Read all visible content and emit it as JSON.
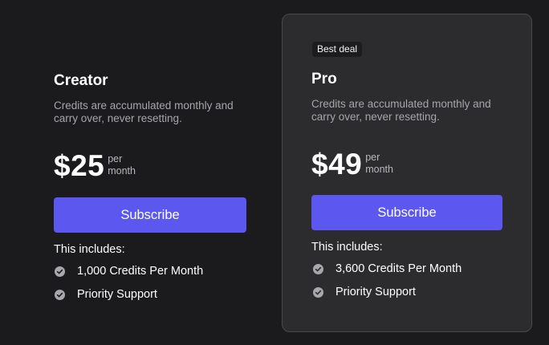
{
  "plans": [
    {
      "name": "Creator",
      "description": "Credits are accumulated monthly and carry over, never resetting.",
      "price": "$25",
      "period_line1": "per",
      "period_line2": "month",
      "button_label": "Subscribe",
      "includes_label": "This includes:",
      "features": [
        "1,000 Credits Per Month",
        "Priority Support"
      ]
    },
    {
      "badge": "Best deal",
      "name": "Pro",
      "description": "Credits are accumulated monthly and carry over, never resetting.",
      "price": "$49",
      "period_line1": "per",
      "period_line2": "month",
      "button_label": "Subscribe",
      "includes_label": "This includes:",
      "features": [
        "3,600 Credits Per Month",
        "Priority Support"
      ]
    }
  ],
  "colors": {
    "background": "#1b1a1d",
    "featured_card": "#2c2b2e",
    "button": "#5b57ef",
    "muted_text": "#a7a6aa"
  },
  "icons": {
    "feature_check": "check-circle-icon"
  }
}
